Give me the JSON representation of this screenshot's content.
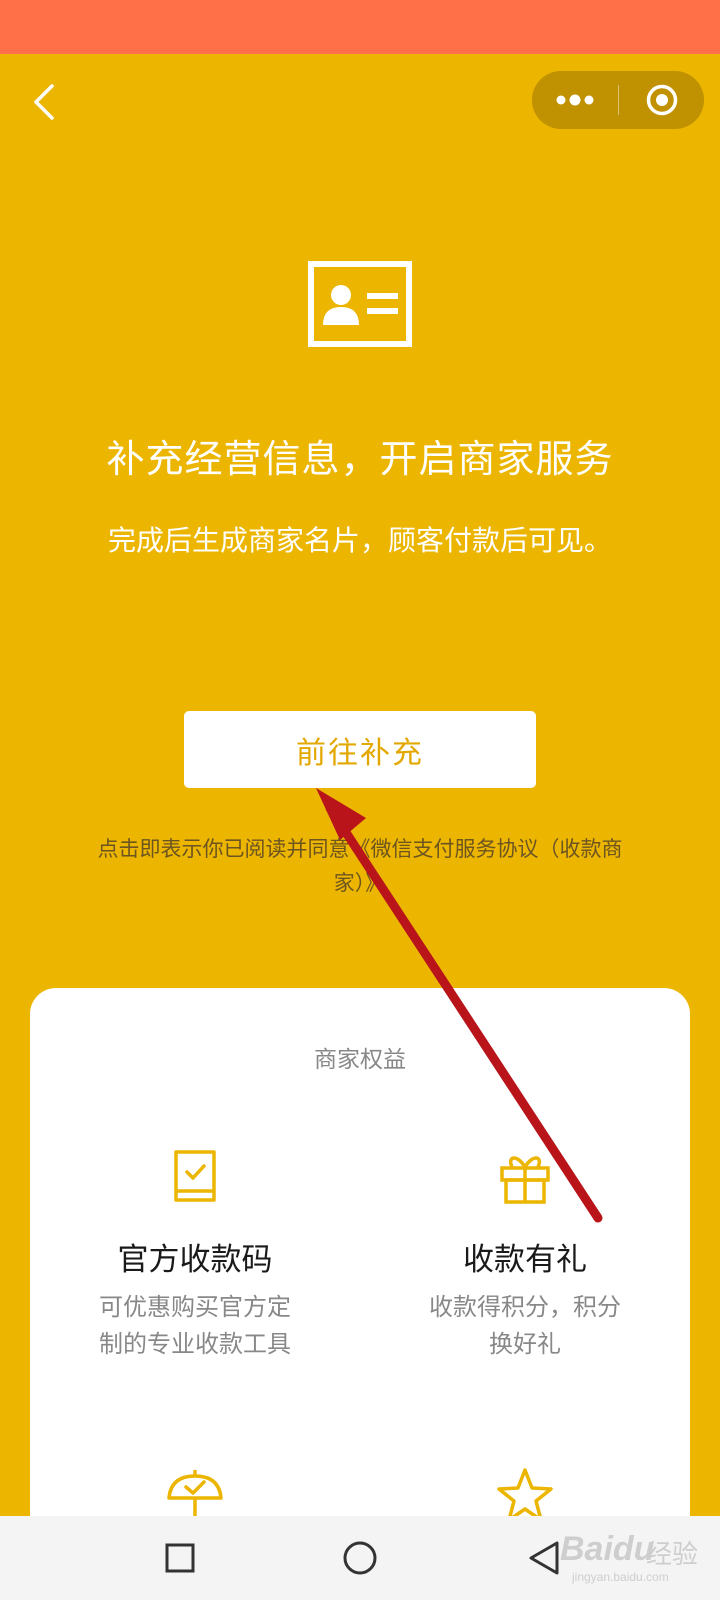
{
  "colors": {
    "status_bar": "#ff7048",
    "page_background": "#ecb500",
    "button_text": "#e3a800",
    "benefit_icon": "#ecb500",
    "annotation_arrow": "#b8141a"
  },
  "nav": {
    "back_icon": "chevron-left-icon",
    "more_icon": "more-dots-icon",
    "close_icon": "target-close-icon"
  },
  "hero": {
    "icon": "id-card-icon",
    "title": "补充经营信息，开启商家服务",
    "subtitle": "完成后生成商家名片，顾客付款后可见。"
  },
  "primary_button": {
    "label": "前往补充"
  },
  "agreement": {
    "text": "点击即表示你已阅读并同意《微信支付服务协议（收款商家）》"
  },
  "benefits": {
    "title": "商家权益",
    "items": [
      {
        "icon": "qr-book-icon",
        "title": "官方收款码",
        "desc": "可优惠购买官方定制的专业收款工具"
      },
      {
        "icon": "gift-icon",
        "title": "收款有礼",
        "desc": "收款得积分，积分换好礼"
      },
      {
        "icon": "umbrella-icon",
        "title": "",
        "desc": ""
      },
      {
        "icon": "star-icon",
        "title": "",
        "desc": ""
      }
    ]
  },
  "system_nav": {
    "recent_icon": "square-recent-icon",
    "home_icon": "circle-home-icon",
    "back_icon": "triangle-back-icon"
  },
  "watermark": {
    "logo": "Baidu",
    "label": "经验",
    "url": "jingyan.baidu.com"
  }
}
